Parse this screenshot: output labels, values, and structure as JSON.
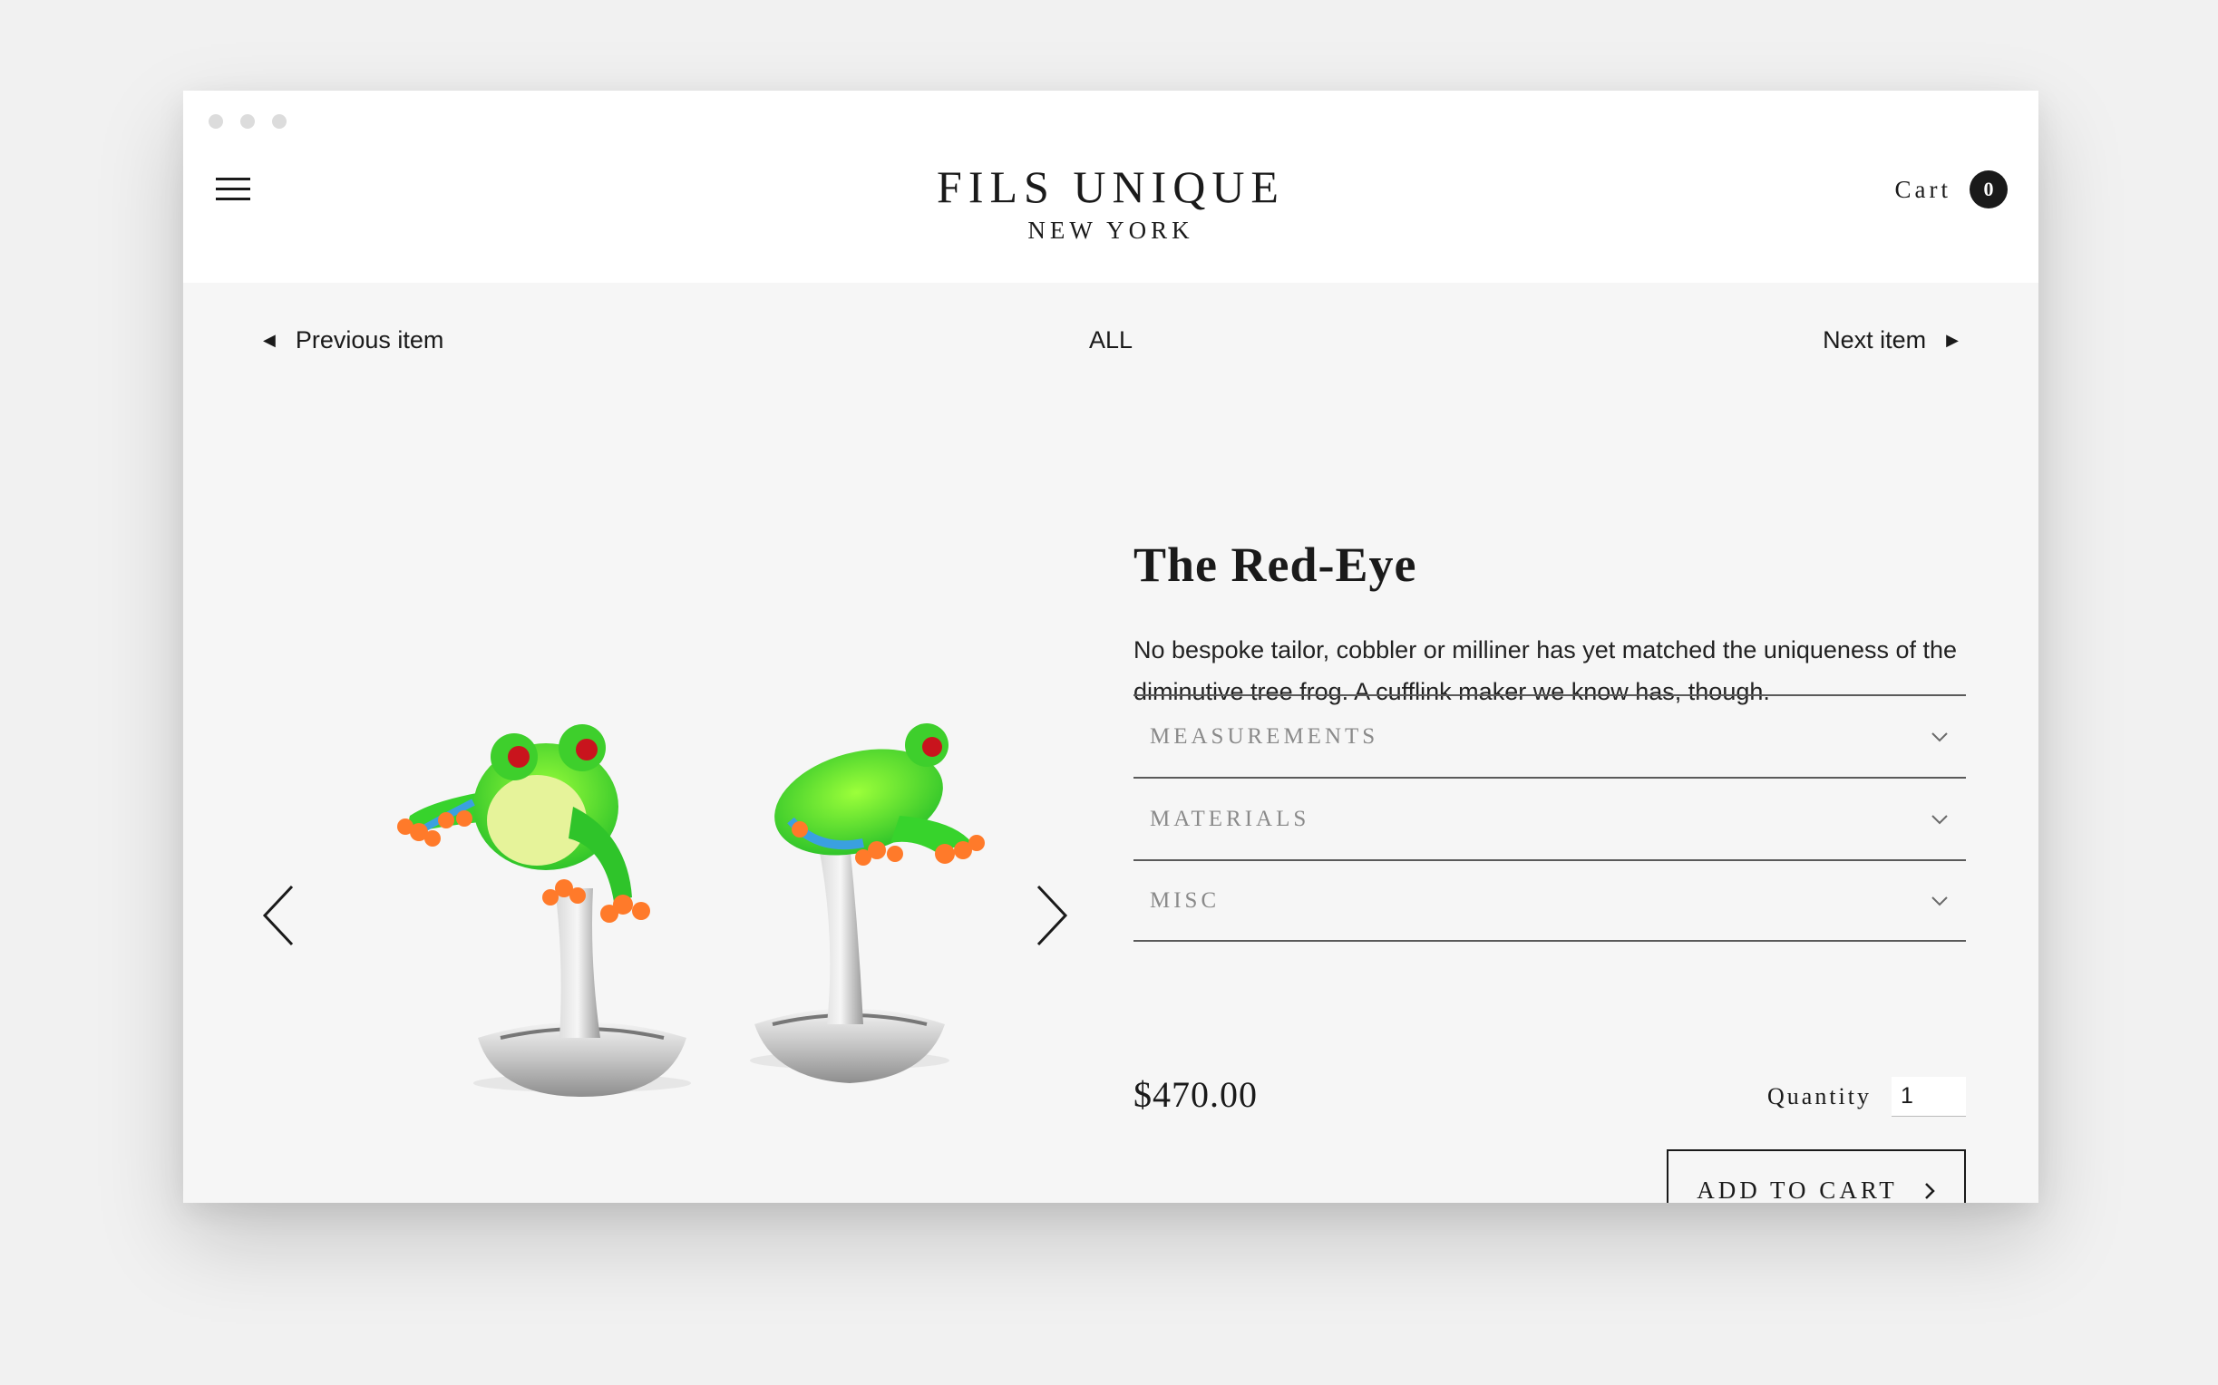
{
  "brand": {
    "name": "FILS UNIQUE",
    "city": "NEW YORK"
  },
  "header": {
    "cart_label": "Cart",
    "cart_count": "0"
  },
  "item_nav": {
    "previous_label": "Previous item",
    "all_label": "ALL",
    "next_label": "Next item"
  },
  "product": {
    "title": "The Red-Eye",
    "description": "No bespoke tailor, cobbler or milliner has yet matched the uniqueness of the diminutive tree frog. A cufflink maker we know has, though.",
    "price": "$470.00",
    "quantity_label": "Quantity",
    "quantity_value": "1",
    "add_to_cart_label": "ADD TO CART",
    "image_icon": "frog-cufflinks-image"
  },
  "accordion": {
    "items": [
      {
        "label": "MEASUREMENTS"
      },
      {
        "label": "MATERIALS"
      },
      {
        "label": "MISC"
      }
    ]
  },
  "colors": {
    "accent": "#1a1a1a",
    "page_background": "#f6f6f6",
    "header_background": "#ffffff",
    "muted_text": "#8a8a8a"
  }
}
